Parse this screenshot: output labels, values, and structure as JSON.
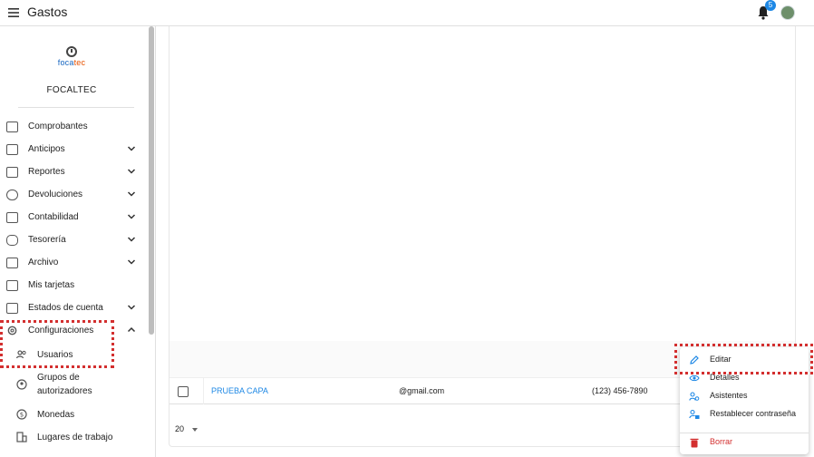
{
  "app": {
    "title": "Gastos",
    "notification_count": "5"
  },
  "sidebar": {
    "logo_text_1": "foca",
    "logo_text_2": "tec",
    "company": "FOCALTEC",
    "items": [
      {
        "label": "Comprobantes",
        "icon": "document-icon",
        "expandable": false
      },
      {
        "label": "Anticipos",
        "icon": "cash-icon",
        "expandable": true
      },
      {
        "label": "Reportes",
        "icon": "report-icon",
        "expandable": true
      },
      {
        "label": "Devoluciones",
        "icon": "refund-icon",
        "expandable": true
      },
      {
        "label": "Contabilidad",
        "icon": "bank-icon",
        "expandable": true
      },
      {
        "label": "Tesorería",
        "icon": "piggy-bank-icon",
        "expandable": true
      },
      {
        "label": "Archivo",
        "icon": "archive-icon",
        "expandable": true
      },
      {
        "label": "Mis tarjetas",
        "icon": "credit-card-icon",
        "expandable": false
      },
      {
        "label": "Estados de cuenta",
        "icon": "statement-icon",
        "expandable": true
      },
      {
        "label": "Configuraciones",
        "icon": "gear-icon",
        "expandable": true,
        "expanded": true
      }
    ],
    "subitems": [
      {
        "label": "Usuarios",
        "icon": "users-icon"
      },
      {
        "label": "Grupos de autorizadores",
        "icon": "group-icon"
      },
      {
        "label": "Monedas",
        "icon": "currency-icon"
      },
      {
        "label": "Lugares de trabajo",
        "icon": "building-icon"
      }
    ]
  },
  "table": {
    "row": {
      "name": "PRUEBA CAPA",
      "email": "@gmail.com",
      "phone": "(123) 456-7890"
    },
    "page_size": "20"
  },
  "context_menu": {
    "items": [
      {
        "label": "Editar",
        "icon": "pencil-icon"
      },
      {
        "label": "Detalles",
        "icon": "eye-icon"
      },
      {
        "label": "Asistentes",
        "icon": "assistants-icon"
      },
      {
        "label": "Restablecer contraseña",
        "icon": "lock-reset-icon"
      },
      {
        "label": "Borrar",
        "icon": "trash-icon"
      }
    ]
  },
  "colors": {
    "accent": "#1e88e5",
    "danger": "#d32f2f",
    "highlight_dots": "#d32f2f"
  }
}
